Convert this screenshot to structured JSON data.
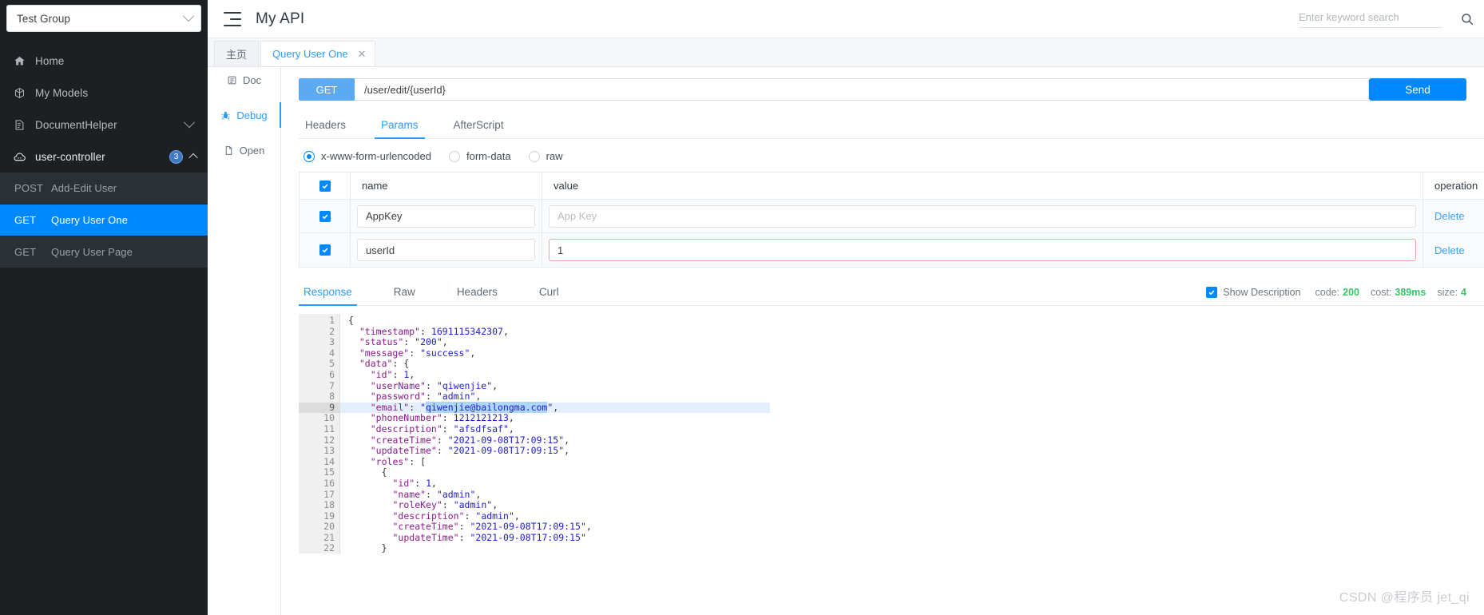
{
  "sidebar": {
    "group_select": {
      "value": "Test Group",
      "icon": "chevron-down-icon"
    },
    "nav": [
      {
        "label": "Home",
        "icon": "home-icon"
      },
      {
        "label": "My Models",
        "icon": "cube-icon"
      },
      {
        "label": "DocumentHelper",
        "icon": "document-icon",
        "trailing_icon": "chevron-down-icon"
      },
      {
        "label": "user-controller",
        "icon": "cloud-api-icon",
        "badge": "3",
        "trailing_icon": "chevron-up-icon",
        "expanded": true
      }
    ],
    "api_items": [
      {
        "method": "POST",
        "name": "Add-Edit User",
        "selected": false
      },
      {
        "method": "GET",
        "name": "Query User One",
        "selected": true
      },
      {
        "method": "GET",
        "name": "Query User Page",
        "selected": false
      }
    ]
  },
  "topbar": {
    "menu_icon": "hamburger-icon",
    "title": "My API",
    "search": {
      "placeholder": "Enter keyword search",
      "value": "",
      "icon": "search-icon"
    }
  },
  "tabstrip": {
    "tabs": [
      {
        "label": "主页",
        "active": false,
        "closable": false
      },
      {
        "label": "Query User One",
        "active": true,
        "closable": true,
        "close_glyph": "✕"
      }
    ]
  },
  "mininav": {
    "items": [
      {
        "label": "Doc",
        "icon": "doc-icon",
        "active": false
      },
      {
        "label": "Debug",
        "icon": "bug-icon",
        "active": true
      },
      {
        "label": "Open",
        "icon": "file-icon",
        "active": false
      }
    ]
  },
  "request": {
    "method": "GET",
    "url": "/user/edit/{userId}",
    "send_label": "Send"
  },
  "request_tabs": [
    {
      "label": "Headers",
      "active": false
    },
    {
      "label": "Params",
      "active": true
    },
    {
      "label": "AfterScript",
      "active": false
    }
  ],
  "body_type_radios": [
    {
      "label": "x-www-form-urlencoded",
      "checked": true
    },
    {
      "label": "form-data",
      "checked": false
    },
    {
      "label": "raw",
      "checked": false
    }
  ],
  "params_table": {
    "headers": {
      "name": "name",
      "value": "value",
      "operation": "operation"
    },
    "header_checked": true,
    "rows": [
      {
        "checked": true,
        "name": "AppKey",
        "value": "",
        "value_placeholder": "App Key",
        "value_invalid": false,
        "operation": "Delete"
      },
      {
        "checked": true,
        "name": "userId",
        "value": "1",
        "value_placeholder": "",
        "value_invalid": true,
        "operation": "Delete"
      }
    ]
  },
  "response": {
    "tabs": [
      {
        "label": "Response",
        "active": true
      },
      {
        "label": "Raw",
        "active": false
      },
      {
        "label": "Headers",
        "active": false
      },
      {
        "label": "Curl",
        "active": false
      }
    ],
    "show_description": {
      "label": "Show Description",
      "checked": true
    },
    "meta": {
      "code_label": "code:",
      "code_value": "200",
      "cost_label": "cost:",
      "cost_value": "389ms",
      "size_label": "size:",
      "size_value": "4"
    },
    "current_line": 9,
    "fold_lines": [
      1,
      5,
      14,
      15
    ],
    "lines": [
      {
        "n": 1,
        "text": "{"
      },
      {
        "n": 2,
        "text": "  \"timestamp\": 1691115342307,"
      },
      {
        "n": 3,
        "text": "  \"status\": \"200\","
      },
      {
        "n": 4,
        "text": "  \"message\": \"success\","
      },
      {
        "n": 5,
        "text": "  \"data\": {"
      },
      {
        "n": 6,
        "text": "    \"id\": 1,"
      },
      {
        "n": 7,
        "text": "    \"userName\": \"qiwenjie\","
      },
      {
        "n": 8,
        "text": "    \"password\": \"admin\","
      },
      {
        "n": 9,
        "text": "    \"email\": \"qiwenjie@bailongma.com\","
      },
      {
        "n": 10,
        "text": "    \"phoneNumber\": 1212121213,"
      },
      {
        "n": 11,
        "text": "    \"description\": \"afsdfsaf\","
      },
      {
        "n": 12,
        "text": "    \"createTime\": \"2021-09-08T17:09:15\","
      },
      {
        "n": 13,
        "text": "    \"updateTime\": \"2021-09-08T17:09:15\","
      },
      {
        "n": 14,
        "text": "    \"roles\": ["
      },
      {
        "n": 15,
        "text": "      {"
      },
      {
        "n": 16,
        "text": "        \"id\": 1,"
      },
      {
        "n": 17,
        "text": "        \"name\": \"admin\","
      },
      {
        "n": 18,
        "text": "        \"roleKey\": \"admin\","
      },
      {
        "n": 19,
        "text": "        \"description\": \"admin\","
      },
      {
        "n": 20,
        "text": "        \"createTime\": \"2021-09-08T17:09:15\","
      },
      {
        "n": 21,
        "text": "        \"updateTime\": \"2021-09-08T17:09:15\""
      },
      {
        "n": 22,
        "text": "      }"
      }
    ]
  },
  "watermark": "CSDN @程序员 jet_qi",
  "colors": {
    "accent": "#0089ff",
    "method_get": "#5cabf2",
    "sidebar_bg": "#1c2023",
    "sidebar_item_bg": "#2a3036",
    "selected": "#0089ff",
    "invalid_border": "#f0a9a1",
    "status_green": "#3cc46a"
  }
}
